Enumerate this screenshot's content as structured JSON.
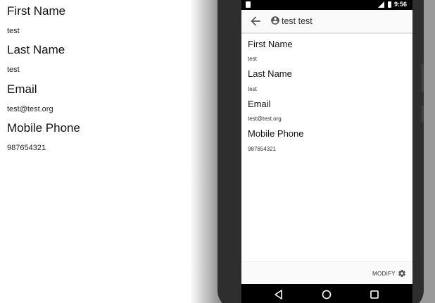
{
  "web_view": {
    "fields": [
      {
        "label": "First Name",
        "value": "test"
      },
      {
        "label": "Last Name",
        "value": "test"
      },
      {
        "label": "Email",
        "value": "test@test.org"
      },
      {
        "label": "Mobile Phone",
        "value": "987654321"
      }
    ]
  },
  "phone": {
    "status_bar": {
      "time": "9:56",
      "icons": [
        "sim-card-icon",
        "signal-icon",
        "battery-icon"
      ]
    },
    "app_bar": {
      "title": "test test",
      "back_icon": "arrow-back-icon",
      "account_icon": "account-circle-icon"
    },
    "fields": [
      {
        "label": "First Name",
        "value": "test"
      },
      {
        "label": "Last Name",
        "value": "test"
      },
      {
        "label": "Email",
        "value": "test@test.org"
      },
      {
        "label": "Mobile Phone",
        "value": "987654321"
      }
    ],
    "bottom_bar": {
      "modify_label": "MODIFY",
      "modify_icon": "gear-icon"
    },
    "nav_bar": {
      "icons": [
        "back-triangle-icon",
        "home-circle-icon",
        "recents-square-icon"
      ]
    }
  }
}
